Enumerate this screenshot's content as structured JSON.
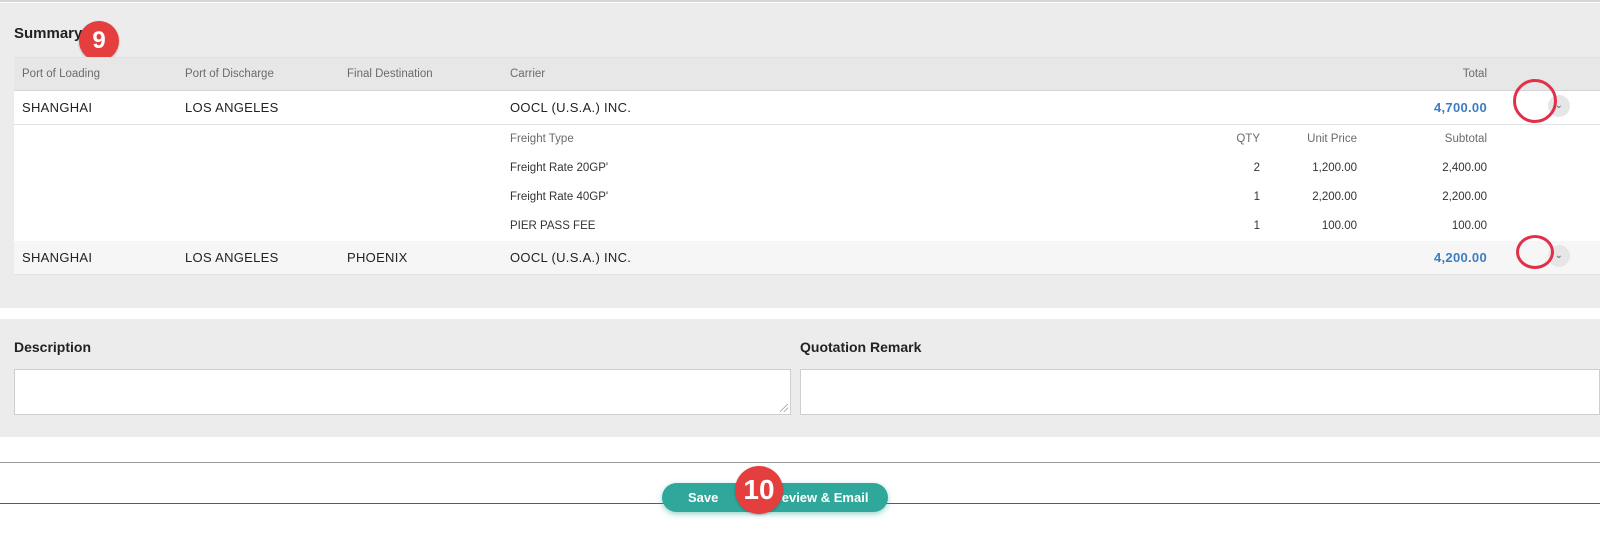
{
  "summary": {
    "title": "Summary",
    "badge": "9",
    "columns": {
      "port_of_loading": "Port of Loading",
      "port_of_discharge": "Port of Discharge",
      "final_destination": "Final Destination",
      "carrier": "Carrier",
      "total": "Total"
    },
    "rows": [
      {
        "port_of_loading": "SHANGHAI",
        "port_of_discharge": "LOS ANGELES",
        "final_destination": "",
        "carrier": "OOCL (U.S.A.) INC.",
        "total": "4,700.00",
        "toggle_icon": "chevron-down-icon",
        "expanded": true,
        "detail": {
          "headers": {
            "freight_type": "Freight Type",
            "qty": "QTY",
            "unit_price": "Unit Price",
            "subtotal": "Subtotal"
          },
          "items": [
            {
              "freight_type": "Freight Rate 20GP'",
              "qty": "2",
              "unit_price": "1,200.00",
              "subtotal": "2,400.00"
            },
            {
              "freight_type": "Freight Rate 40GP'",
              "qty": "1",
              "unit_price": "2,200.00",
              "subtotal": "2,200.00"
            },
            {
              "freight_type": "PIER PASS FEE",
              "qty": "1",
              "unit_price": "100.00",
              "subtotal": "100.00"
            }
          ]
        }
      },
      {
        "port_of_loading": "SHANGHAI",
        "port_of_discharge": "LOS ANGELES",
        "final_destination": "PHOENIX",
        "carrier": "OOCL (U.S.A.) INC.",
        "total": "4,200.00",
        "toggle_icon": "chevron-down-icon",
        "expanded": false
      }
    ]
  },
  "description": {
    "label": "Description",
    "value": ""
  },
  "quotation_remark": {
    "label": "Quotation Remark",
    "value": ""
  },
  "actions": {
    "badge": "10",
    "save_label": "Save",
    "preview_label": "Preview & Email"
  },
  "colors": {
    "accent": "#2fa89b",
    "total_text": "#3b7dc4",
    "annotation": "#e53e3e"
  }
}
